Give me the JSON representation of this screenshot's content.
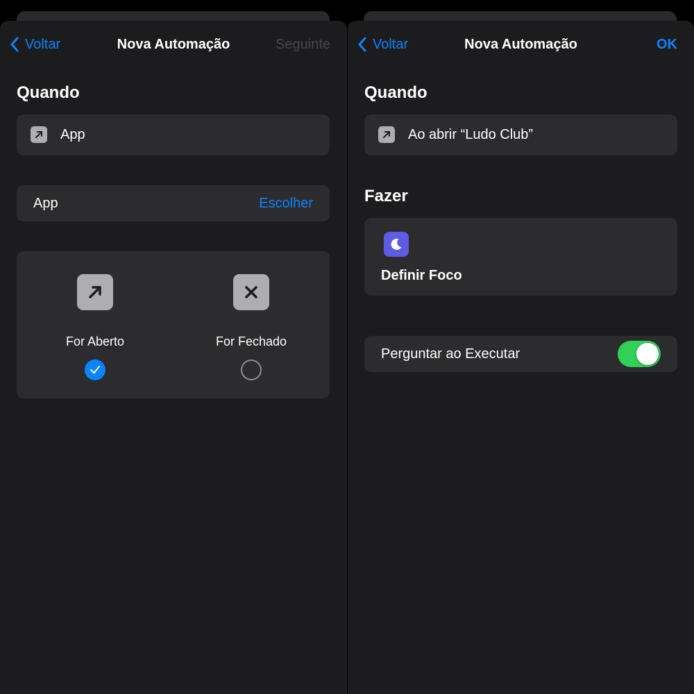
{
  "left": {
    "nav": {
      "back_label": "Voltar",
      "title": "Nova Automação",
      "next_label": "Seguinte"
    },
    "when_title": "Quando",
    "trigger_label": "App",
    "app_row": {
      "label": "App",
      "choose_label": "Escolher"
    },
    "options": [
      {
        "label": "For Aberto",
        "icon": "arrow-up-right-icon",
        "selected": true
      },
      {
        "label": "For Fechado",
        "icon": "x-icon",
        "selected": false
      }
    ]
  },
  "right": {
    "nav": {
      "back_label": "Voltar",
      "title": "Nova Automação",
      "done_label": "OK"
    },
    "when_title": "Quando",
    "trigger_label": "Ao abrir “Ludo Club”",
    "do_title": "Fazer",
    "action": {
      "icon": "moon-icon",
      "title": "Definir Foco"
    },
    "ask_row": {
      "label": "Perguntar ao Executar",
      "enabled": true
    }
  },
  "colors": {
    "accent": "#0a84ff",
    "background": "#1c1c1e",
    "card": "#2c2c2e",
    "toggle_on": "#30d158",
    "focus_icon": "#5e5ce6"
  }
}
